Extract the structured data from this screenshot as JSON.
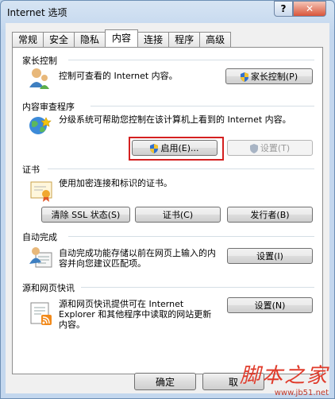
{
  "window": {
    "title": "Internet 选项",
    "help_glyph": "?",
    "close_glyph": "✕"
  },
  "tabs": [
    {
      "label": "常规",
      "active": false
    },
    {
      "label": "安全",
      "active": false
    },
    {
      "label": "隐私",
      "active": false
    },
    {
      "label": "内容",
      "active": true
    },
    {
      "label": "连接",
      "active": false
    },
    {
      "label": "程序",
      "active": false
    },
    {
      "label": "高级",
      "active": false
    }
  ],
  "parental": {
    "title": "家长控制",
    "description": "控制可查看的 Internet 内容。",
    "button": "家长控制(P)"
  },
  "advisor": {
    "title": "内容审查程序",
    "description": "分级系统可帮助您控制在该计算机上看到的 Internet 内容。",
    "enable_button": "启用(E)...",
    "settings_button": "设置(T)"
  },
  "certificates": {
    "title": "证书",
    "description": "使用加密连接和标识的证书。",
    "clear_ssl_button": "清除 SSL 状态(S)",
    "certificates_button": "证书(C)",
    "publishers_button": "发行者(B)"
  },
  "autocomplete": {
    "title": "自动完成",
    "description": "自动完成功能存储以前在网页上输入的内容并向您建议匹配项。",
    "settings_button": "设置(I)"
  },
  "feeds": {
    "title": "源和网页快讯",
    "description": "源和网页快讯提供可在 Internet Explorer 和其他程序中读取的网站更新内容。",
    "settings_button": "设置(N)"
  },
  "footer": {
    "ok_button": "确定",
    "cancel_button": "取"
  },
  "watermark": {
    "main": "脚本之家",
    "url": "www.jb51.net"
  },
  "colors": {
    "highlight": "#d42020",
    "window_border": "#6d8fb5"
  }
}
